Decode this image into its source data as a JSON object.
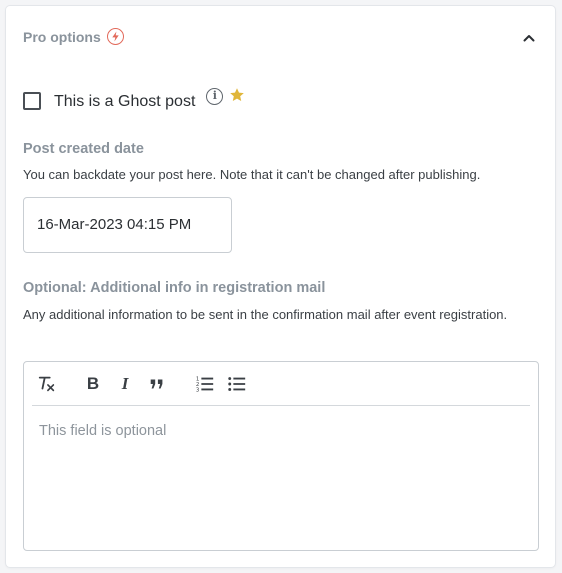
{
  "panel": {
    "title": "Pro options",
    "icons": {
      "title_badge": "bolt-icon",
      "collapse": "chevron-up-icon"
    },
    "colors": {
      "badge": "#e26a5b",
      "star": "#e0b63a",
      "muted_title": "#8a939c"
    }
  },
  "ghost_post": {
    "label": "This is a Ghost post",
    "checked": false,
    "info_glyph": "i",
    "icons": [
      "info-icon",
      "star-icon"
    ]
  },
  "post_date": {
    "title": "Post created date",
    "description": "You can backdate your post here. Note that it can't be changed after publishing.",
    "value": "16-Mar-2023 04:15 PM"
  },
  "registration_mail": {
    "title": "Optional: Additional info in registration mail",
    "description": "Any additional information to be sent in the confirmation mail after event registration.",
    "placeholder": "This field is optional",
    "toolbar": {
      "bold_glyph": "B",
      "italic_glyph": "I",
      "quote_glyph": "”",
      "buttons": [
        "clear-formatting-icon",
        "bold-icon",
        "italic-icon",
        "blockquote-icon",
        "ordered-list-icon",
        "bullet-list-icon"
      ]
    }
  }
}
